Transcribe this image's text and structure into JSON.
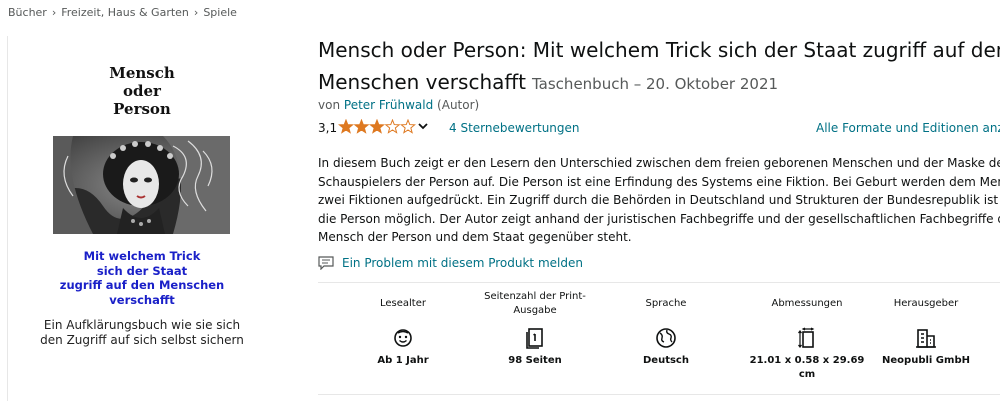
{
  "breadcrumb": [
    "Bücher",
    "Freizeit, Haus & Garten",
    "Spiele"
  ],
  "cover": {
    "title_lines": [
      "Mensch",
      "oder",
      "Person"
    ],
    "subtitle_lines": [
      "Mit welchem Trick",
      "sich der Staat",
      "zugriff auf den Menschen",
      "verschafft"
    ],
    "footer_lines": [
      "Ein Aufklärungsbuch wie sie sich",
      "den Zugriff auf sich selbst sichern"
    ]
  },
  "product": {
    "title_line1": "Mensch oder Person: Mit welchem Trick sich der Staat zugriff auf den",
    "title_line2": "Menschen verschafft",
    "format": "Taschenbuch – 20. Oktober 2021",
    "by_prefix": "von",
    "author": "Peter Frühwald",
    "author_role": "(Autor)",
    "rating_value": "3,1",
    "rating_stars": 3.1,
    "ratings_count_label": "4 Sternebewertungen",
    "formats_link": "Alle Formate und Editionen anze",
    "description_lines": [
      "In diesem Buch zeigt er den Lesern den Unterschied zwischen dem freien geborenen Menschen und der Maske des",
      "Schauspielers der Person auf. Die Person ist eine Erfindung des Systems eine Fiktion. Bei Geburt werden dem Menschen",
      "zwei Fiktionen aufgedrückt. Ein Zugriff durch die Behörden in Deutschland und Strukturen der Bundesrepublik ist nur au",
      "die Person möglich. Der Autor zeigt anhand der juristischen Fachbegriffe und der gesellschaftlichen Fachbegriffe das de",
      "Mensch der Person und dem Staat gegenüber steht."
    ],
    "report_link": "Ein Problem mit diesem Produkt melden"
  },
  "attributes": [
    {
      "label": "Lesealter",
      "value": "Ab 1 Jahr",
      "icon": "face-icon"
    },
    {
      "label": "Seitenzahl der Print-Ausgabe",
      "value": "98 Seiten",
      "icon": "pages-icon"
    },
    {
      "label": "Sprache",
      "value": "Deutsch",
      "icon": "globe-icon"
    },
    {
      "label": "Abmessungen",
      "value": "21.01 x 0.58 x 29.69 cm",
      "icon": "dimensions-icon"
    },
    {
      "label": "Herausgeber",
      "value": "Neopubli GmbH",
      "icon": "building-icon"
    }
  ],
  "colors": {
    "link": "#007185",
    "star": "#de7921",
    "cover_subtitle": "#1a20c8"
  }
}
